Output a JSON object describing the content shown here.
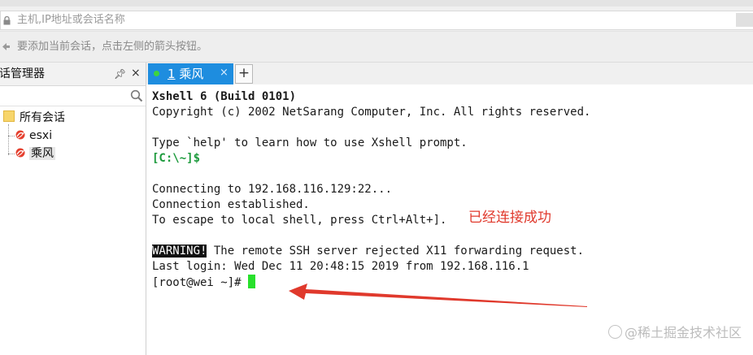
{
  "address_bar": {
    "placeholder": "主机,IP地址或会话名称",
    "lock_icon": "lock-icon"
  },
  "hint_bar": {
    "text": "要添加当前会话，点击左侧的箭头按钮。",
    "icon": "arrow-icon"
  },
  "session_panel": {
    "title": "话管理器",
    "pin_icon": "pin-icon",
    "close_icon": "close-icon",
    "search_icon": "search-icon",
    "tree": {
      "root": "所有会话",
      "items": [
        {
          "label": "esxi",
          "icon": "xshell-session-icon"
        },
        {
          "label": "乘风",
          "icon": "xshell-session-icon",
          "selected": true
        }
      ]
    }
  },
  "tabs": {
    "active": {
      "number": "1",
      "label": "乘风",
      "status_color": "#3ed43e"
    },
    "close_symbol": "×",
    "add_symbol": "+"
  },
  "terminal": {
    "lines": [
      "Xshell 6 (Build 0101)",
      "Copyright (c) 2002 NetSarang Computer, Inc. All rights reserved.",
      "",
      "Type `help' to learn how to use Xshell prompt.",
      "[C:\\~]$",
      "",
      "Connecting to 192.168.116.129:22...",
      "Connection established.",
      "To escape to local shell, press Ctrl+Alt+].",
      "",
      "WARNING!",
      " The remote SSH server rejected X11 forwarding request.",
      "Last login: Wed Dec 11 20:48:15 2019 from 192.168.116.1",
      "[root@wei ~]# "
    ],
    "cursor_color": "#28e02c"
  },
  "annotation": {
    "note": "已经连接成功",
    "color": "#e0392c"
  },
  "watermark": "@稀土掘金技术社区"
}
